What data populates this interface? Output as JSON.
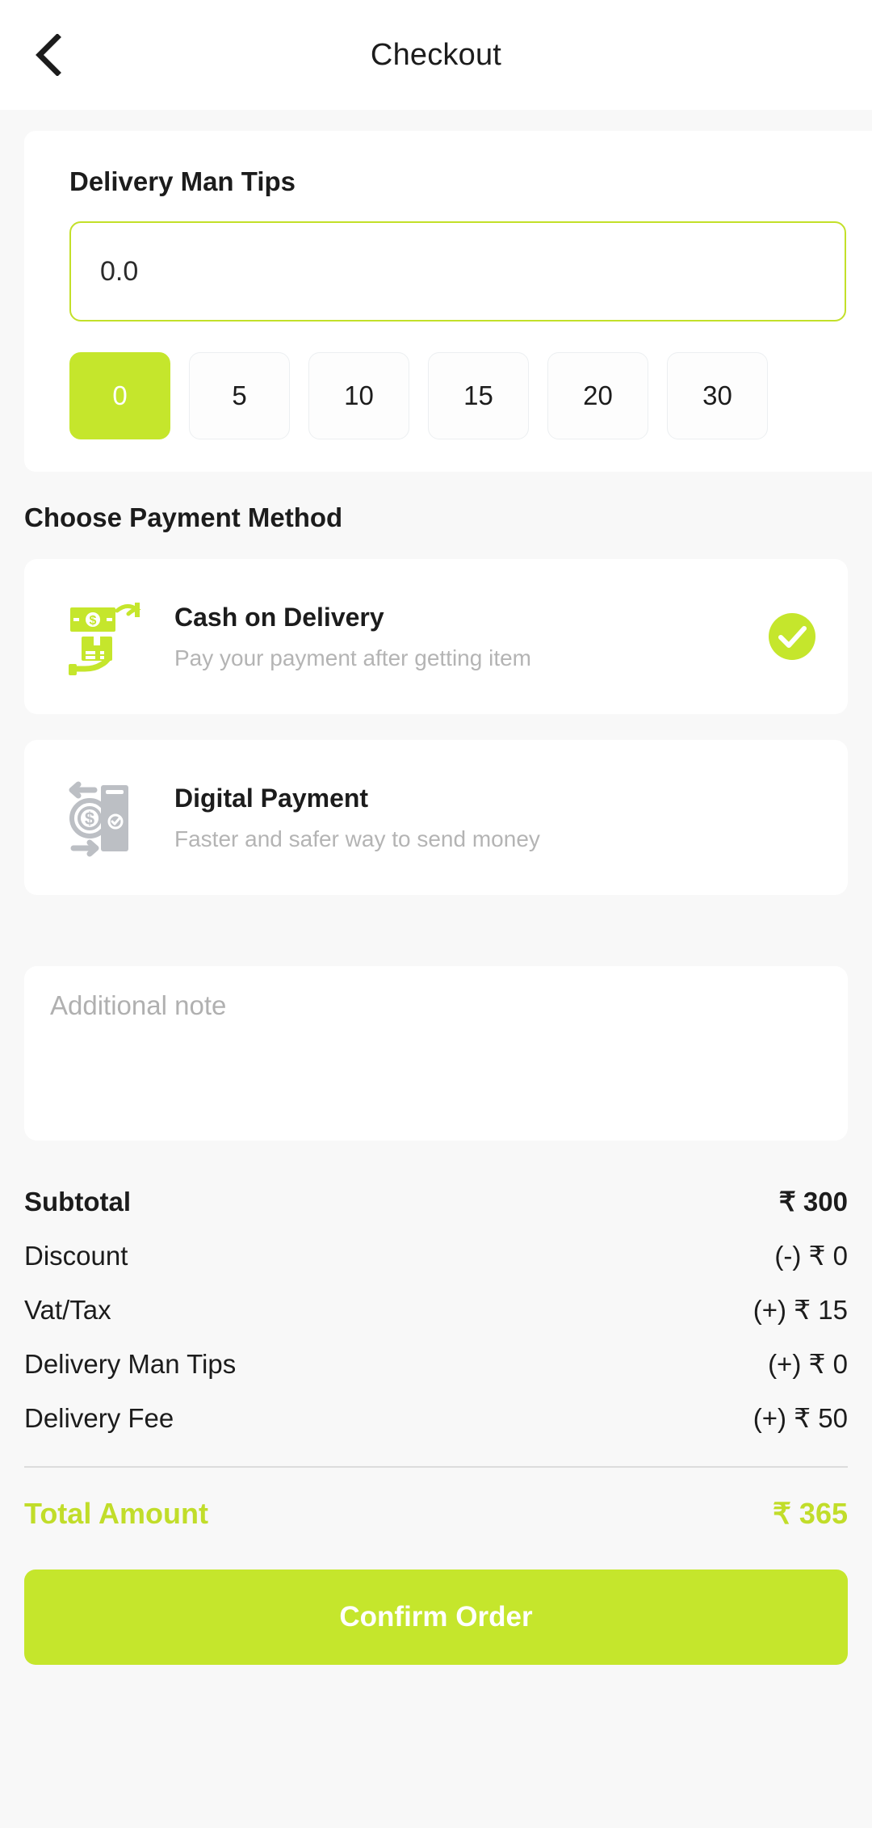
{
  "theme": {
    "accent": "#c5e62c",
    "accent_text": "#c1dd2a",
    "page_bg": "#f8f8f8",
    "card_bg": "#ffffff",
    "muted_text": "#b4b4b4"
  },
  "appbar": {
    "title": "Checkout",
    "back_icon": "chevron-left-icon"
  },
  "tips": {
    "label": "Delivery Man Tips",
    "input_value": "0.0",
    "input_placeholder": "0.0",
    "options": [
      {
        "label": "0",
        "selected": true
      },
      {
        "label": "5",
        "selected": false
      },
      {
        "label": "10",
        "selected": false
      },
      {
        "label": "15",
        "selected": false
      },
      {
        "label": "20",
        "selected": false
      },
      {
        "label": "30",
        "selected": false
      }
    ]
  },
  "payment": {
    "heading": "Choose Payment Method",
    "methods": [
      {
        "title": "Cash on Delivery",
        "subtitle": "Pay your payment after getting item",
        "icon": "cash-on-delivery-icon",
        "selected": true
      },
      {
        "title": "Digital Payment",
        "subtitle": "Faster and safer way to send money",
        "icon": "digital-payment-icon",
        "selected": false
      }
    ],
    "check_icon": "check-circle-icon"
  },
  "note": {
    "placeholder": "Additional note",
    "value": ""
  },
  "summary": {
    "rows": [
      {
        "label": "Subtotal",
        "value": "₹ 300",
        "bold": true
      },
      {
        "label": "Discount",
        "value": "(-) ₹ 0",
        "bold": false
      },
      {
        "label": "Vat/Tax",
        "value": "(+) ₹ 15",
        "bold": false
      },
      {
        "label": "Delivery Man Tips",
        "value": "(+) ₹ 0",
        "bold": false
      },
      {
        "label": "Delivery Fee",
        "value": "(+) ₹ 50",
        "bold": false
      }
    ],
    "total_label": "Total Amount",
    "total_value": "₹ 365"
  },
  "confirm": {
    "label": "Confirm Order"
  }
}
